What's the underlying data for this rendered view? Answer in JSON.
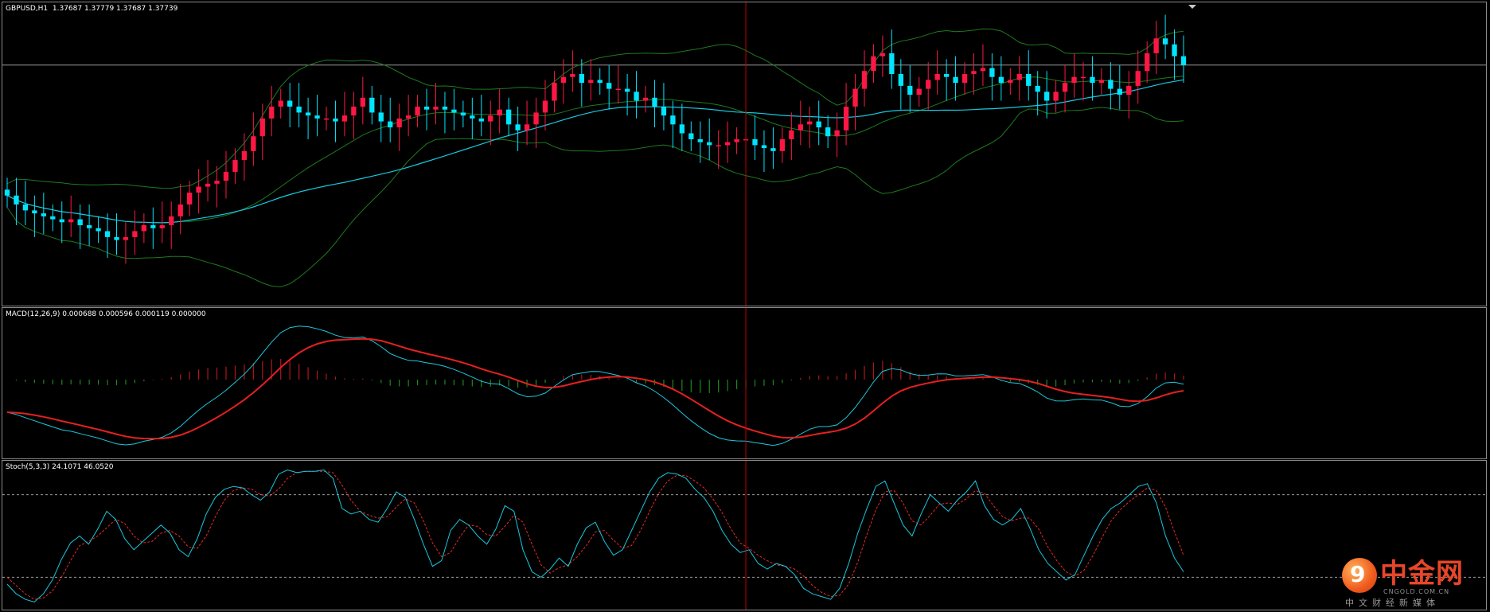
{
  "main": {
    "label": "GBPUSD,H1  1.37687 1.37779 1.37687 1.37739",
    "price_level_line": 1.3774
  },
  "macd": {
    "label": "MACD(12,26,9) 0.000688 0.000596 0.000119 0.000000"
  },
  "stoch": {
    "label": "Stoch(5,3,3) 24.1071 46.0520",
    "upper_level": 80,
    "lower_level": 20
  },
  "watermark": {
    "title": "中金网",
    "subtitle": "CNGOLD.COM.CN",
    "tagline": "中文财经新媒体",
    "glyph": "9"
  },
  "colors": {
    "bull_candle": "#00e5ff",
    "bear_candle": "#ff1744",
    "ma_line": "#16c8e0",
    "bollinger": "#1e7a1e",
    "macd_main": "#e62020",
    "macd_signal": "#1ec8dc",
    "hist_pos": "#b01818",
    "hist_neg": "#1a8a1a",
    "stoch_main": "#18c8dc",
    "stoch_signal": "#e82828",
    "level_line": "#9a9a9a",
    "cursor_line": "#c00000",
    "frame": "#8a8a8a"
  },
  "chart_data": [
    {
      "type": "candlestick",
      "title": "GBPUSD,H1",
      "series": [
        {
          "name": "close",
          "values": [
            1.373,
            1.3727,
            1.3725,
            1.3724,
            1.3723,
            1.3722,
            1.3721,
            1.3722,
            1.372,
            1.3719,
            1.3718,
            1.3716,
            1.3715,
            1.3716,
            1.3718,
            1.372,
            1.3719,
            1.372,
            1.3723,
            1.3727,
            1.3731,
            1.3733,
            1.3734,
            1.3735,
            1.3738,
            1.3742,
            1.3745,
            1.375,
            1.3756,
            1.376,
            1.3762,
            1.376,
            1.3758,
            1.3757,
            1.3756,
            1.3756,
            1.3755,
            1.3757,
            1.376,
            1.3763,
            1.3758,
            1.3755,
            1.3753,
            1.3756,
            1.3757,
            1.376,
            1.3759,
            1.376,
            1.3759,
            1.3758,
            1.3757,
            1.3756,
            1.3755,
            1.3757,
            1.3759,
            1.3754,
            1.3752,
            1.3754,
            1.3758,
            1.3762,
            1.3768,
            1.377,
            1.3771,
            1.3768,
            1.3769,
            1.3768,
            1.3766,
            1.3766,
            1.3765,
            1.3762,
            1.3763,
            1.376,
            1.3757,
            1.3754,
            1.3751,
            1.3749,
            1.3748,
            1.3747,
            1.3747,
            1.3748,
            1.3749,
            1.3749,
            1.3747,
            1.3746,
            1.3745,
            1.3749,
            1.3752,
            1.3754,
            1.3755,
            1.3753,
            1.375,
            1.3752,
            1.376,
            1.3766,
            1.3772,
            1.3777,
            1.3778,
            1.3771,
            1.3767,
            1.3764,
            1.3766,
            1.3769,
            1.3771,
            1.377,
            1.3768,
            1.3771,
            1.3772,
            1.3773,
            1.377,
            1.3768,
            1.3769,
            1.3771,
            1.3767,
            1.3765,
            1.3762,
            1.3765,
            1.3768,
            1.377,
            1.377,
            1.3768,
            1.3769,
            1.3766,
            1.3764,
            1.3767,
            1.3772,
            1.3778,
            1.3783,
            1.3781,
            1.3777,
            1.3774
          ]
        }
      ],
      "price_level": 1.3774
    },
    {
      "type": "line",
      "title": "MACD(12,26,9)",
      "series": [
        {
          "name": "main",
          "values": [
            0.000688
          ]
        },
        {
          "name": "signal",
          "values": [
            0.000596
          ]
        }
      ]
    },
    {
      "type": "line",
      "title": "Stoch(5,3,3)",
      "ylim": [
        0,
        100
      ],
      "levels": [
        80,
        20
      ],
      "series": [
        {
          "name": "main",
          "values": [
            15,
            8,
            4,
            2,
            8,
            18,
            33,
            45,
            50,
            44,
            55,
            68,
            62,
            48,
            40,
            46,
            52,
            58,
            52,
            40,
            35,
            48,
            66,
            78,
            84,
            86,
            85,
            80,
            76,
            82,
            95,
            98,
            96,
            97,
            97,
            98,
            92,
            70,
            66,
            68,
            62,
            60,
            70,
            82,
            78,
            62,
            44,
            28,
            32,
            54,
            62,
            58,
            50,
            44,
            55,
            72,
            68,
            40,
            24,
            20,
            26,
            34,
            28,
            44,
            56,
            60,
            46,
            36,
            40,
            54,
            68,
            82,
            92,
            96,
            95,
            92,
            84,
            78,
            68,
            54,
            44,
            38,
            40,
            30,
            26,
            30,
            28,
            22,
            12,
            8,
            6,
            4,
            12,
            30,
            52,
            70,
            86,
            90,
            74,
            58,
            50,
            66,
            80,
            74,
            68,
            76,
            82,
            90,
            72,
            62,
            58,
            62,
            70,
            56,
            40,
            30,
            24,
            18,
            22,
            36,
            50,
            62,
            70,
            74,
            80,
            86,
            88,
            74,
            50,
            34,
            24
          ]
        },
        {
          "name": "signal",
          "values": [
            20,
            14,
            8,
            4,
            5,
            10,
            20,
            32,
            43,
            46,
            50,
            56,
            62,
            59,
            50,
            45,
            46,
            52,
            54,
            50,
            42,
            41,
            50,
            64,
            76,
            83,
            85,
            84,
            80,
            79,
            84,
            92,
            96,
            97,
            97,
            97,
            96,
            87,
            76,
            68,
            65,
            63,
            64,
            71,
            77,
            74,
            61,
            45,
            35,
            38,
            49,
            58,
            57,
            51,
            50,
            57,
            65,
            60,
            44,
            29,
            23,
            27,
            29,
            35,
            43,
            53,
            54,
            47,
            41,
            43,
            54,
            68,
            81,
            90,
            94,
            94,
            90,
            85,
            77,
            67,
            55,
            45,
            41,
            36,
            32,
            29,
            28,
            26,
            21,
            14,
            9,
            6,
            7,
            15,
            31,
            51,
            69,
            82,
            83,
            74,
            61,
            58,
            65,
            73,
            74,
            73,
            77,
            83,
            81,
            72,
            64,
            61,
            63,
            63,
            55,
            42,
            32,
            24,
            21,
            25,
            36,
            49,
            61,
            69,
            75,
            80,
            85,
            83,
            71,
            53,
            36
          ]
        }
      ]
    }
  ]
}
